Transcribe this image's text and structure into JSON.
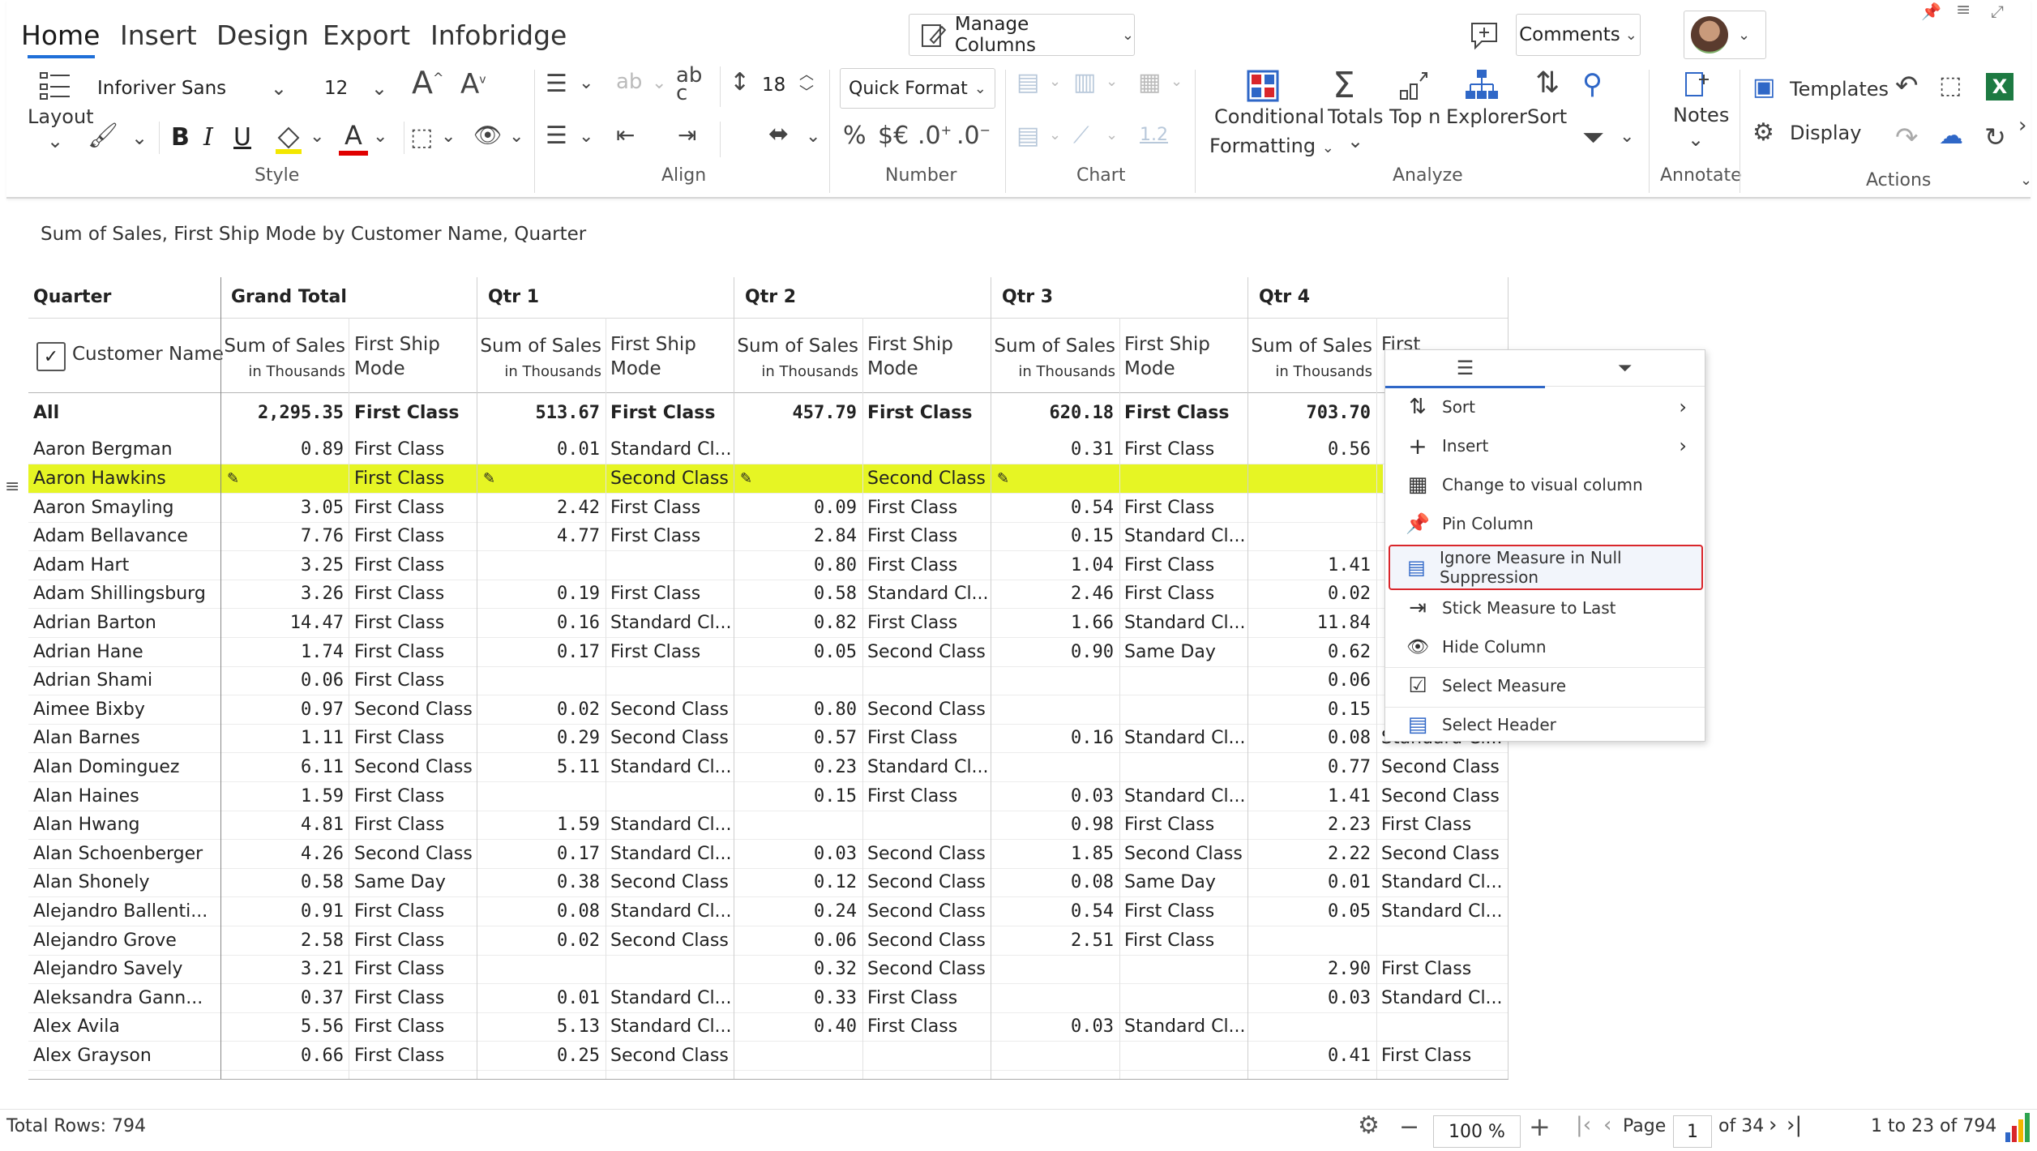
{
  "tabs": [
    "Home",
    "Insert",
    "Design",
    "Export",
    "Infobridge"
  ],
  "top": {
    "manage_columns": "Manage Columns",
    "comments": "Comments"
  },
  "style": {
    "font": "Inforiver Sans",
    "size": "12",
    "layout": "Layout",
    "group": "Style",
    "bold": "B",
    "italic": "I",
    "underline": "U",
    "text_color": "#e00000",
    "highlight_color": "#f3e700"
  },
  "align": {
    "group": "Align",
    "row_height": "18"
  },
  "number": {
    "group": "Number",
    "quick_format": "Quick Format",
    "percent": "%",
    "currency": "$€",
    "inc_decimal": ".0",
    "dec_decimal": ".0"
  },
  "chart": {
    "group": "Chart",
    "value": "1.2"
  },
  "analyze": {
    "group": "Analyze",
    "conditional_1": "Conditional",
    "conditional_2": "Formatting",
    "totals": "Totals",
    "topn": "Top n",
    "explorer": "Explorer",
    "sort": "Sort"
  },
  "annotate": {
    "group": "Annotate",
    "notes": "Notes"
  },
  "actions": {
    "group": "Actions",
    "templates": "Templates",
    "display": "Display",
    "excel": "X"
  },
  "caption": "Sum of Sales, First Ship Mode by Customer Name, Quarter",
  "grid": {
    "quarter_label": "Quarter",
    "customer_label": "Customer Name",
    "groups": [
      "Grand Total",
      "Qtr 1",
      "Qtr 2",
      "Qtr 3",
      "Qtr 4"
    ],
    "measure_1": "Sum of Sales",
    "measure_1_sub": "in Thousands",
    "measure_2_a": "First Ship",
    "measure_2_b": "Mode",
    "rows": [
      [
        "All",
        "2,295.35",
        "First Class",
        "513.67",
        "First Class",
        "457.79",
        "First Class",
        "620.18",
        "First Class",
        "703.70",
        ""
      ],
      [
        "Aaron Bergman",
        "0.89",
        "First Class",
        "0.01",
        "Standard Cl...",
        "",
        "",
        "0.31",
        "First Class",
        "0.56",
        ""
      ],
      [
        "Aaron Hawkins",
        "",
        "First Class",
        "",
        "Second Class",
        "",
        "Second Class",
        "",
        "",
        "",
        ""
      ],
      [
        "Aaron Smayling",
        "3.05",
        "First Class",
        "2.42",
        "First Class",
        "0.09",
        "First Class",
        "0.54",
        "First Class",
        "",
        ""
      ],
      [
        "Adam Bellavance",
        "7.76",
        "First Class",
        "4.77",
        "First Class",
        "2.84",
        "First Class",
        "0.15",
        "Standard Cl...",
        "",
        ""
      ],
      [
        "Adam Hart",
        "3.25",
        "First Class",
        "",
        "",
        "0.80",
        "First Class",
        "1.04",
        "First Class",
        "1.41",
        ""
      ],
      [
        "Adam Shillingsburg",
        "3.26",
        "First Class",
        "0.19",
        "First Class",
        "0.58",
        "Standard Cl...",
        "2.46",
        "First Class",
        "0.02",
        ""
      ],
      [
        "Adrian Barton",
        "14.47",
        "First Class",
        "0.16",
        "Standard Cl...",
        "0.82",
        "First Class",
        "1.66",
        "Standard Cl...",
        "11.84",
        ""
      ],
      [
        "Adrian Hane",
        "1.74",
        "First Class",
        "0.17",
        "First Class",
        "0.05",
        "Second Class",
        "0.90",
        "Same Day",
        "0.62",
        ""
      ],
      [
        "Adrian Shami",
        "0.06",
        "First Class",
        "",
        "",
        "",
        "",
        "",
        "",
        "0.06",
        ""
      ],
      [
        "Aimee Bixby",
        "0.97",
        "Second Class",
        "0.02",
        "Second Class",
        "0.80",
        "Second Class",
        "",
        "",
        "0.15",
        ""
      ],
      [
        "Alan Barnes",
        "1.11",
        "First Class",
        "0.29",
        "Second Class",
        "0.57",
        "First Class",
        "0.16",
        "Standard Cl...",
        "0.08",
        "Standard Cl..."
      ],
      [
        "Alan Dominguez",
        "6.11",
        "Second Class",
        "5.11",
        "Standard Cl...",
        "0.23",
        "Standard Cl...",
        "",
        "",
        "0.77",
        "Second Class"
      ],
      [
        "Alan Haines",
        "1.59",
        "First Class",
        "",
        "",
        "0.15",
        "First Class",
        "0.03",
        "Standard Cl...",
        "1.41",
        "Second Class"
      ],
      [
        "Alan Hwang",
        "4.81",
        "First Class",
        "1.59",
        "Standard Cl...",
        "",
        "",
        "0.98",
        "First Class",
        "2.23",
        "First Class"
      ],
      [
        "Alan Schoenberger",
        "4.26",
        "Second Class",
        "0.17",
        "Standard Cl...",
        "0.03",
        "Second Class",
        "1.85",
        "Second Class",
        "2.22",
        "Second Class"
      ],
      [
        "Alan Shonely",
        "0.58",
        "Same Day",
        "0.38",
        "Second Class",
        "0.12",
        "Second Class",
        "0.08",
        "Same Day",
        "0.01",
        "Standard Cl..."
      ],
      [
        "Alejandro Ballenti...",
        "0.91",
        "First Class",
        "0.08",
        "Standard Cl...",
        "0.24",
        "Second Class",
        "0.54",
        "First Class",
        "0.05",
        "Standard Cl..."
      ],
      [
        "Alejandro Grove",
        "2.58",
        "First Class",
        "0.02",
        "Second Class",
        "0.06",
        "Second Class",
        "2.51",
        "First Class",
        "",
        ""
      ],
      [
        "Alejandro Savely",
        "3.21",
        "First Class",
        "",
        "",
        "0.32",
        "Second Class",
        "",
        "",
        "2.90",
        "First Class"
      ],
      [
        "Aleksandra Gann...",
        "0.37",
        "First Class",
        "0.01",
        "Standard Cl...",
        "0.33",
        "First Class",
        "",
        "",
        "0.03",
        "Standard Cl..."
      ],
      [
        "Alex Avila",
        "5.56",
        "First Class",
        "5.13",
        "Standard Cl...",
        "0.40",
        "First Class",
        "0.03",
        "Standard Cl...",
        "",
        ""
      ],
      [
        "Alex Grayson",
        "0.66",
        "First Class",
        "0.25",
        "Second Class",
        "",
        "",
        "",
        "",
        "0.41",
        "First Class"
      ]
    ]
  },
  "context_menu": {
    "items": [
      "Sort",
      "Insert",
      "Change to visual column",
      "Pin Column",
      "Ignore Measure in Null Suppression",
      "Stick Measure to Last",
      "Hide Column",
      "Select Measure",
      "Select Header"
    ],
    "highlight_color": "#d9262b"
  },
  "footer": {
    "total_rows": "Total Rows: 794",
    "zoom": "100 %",
    "page_label": "Page",
    "page": "1",
    "of_pages": "of 34",
    "range": "1 to 23 of 794"
  }
}
